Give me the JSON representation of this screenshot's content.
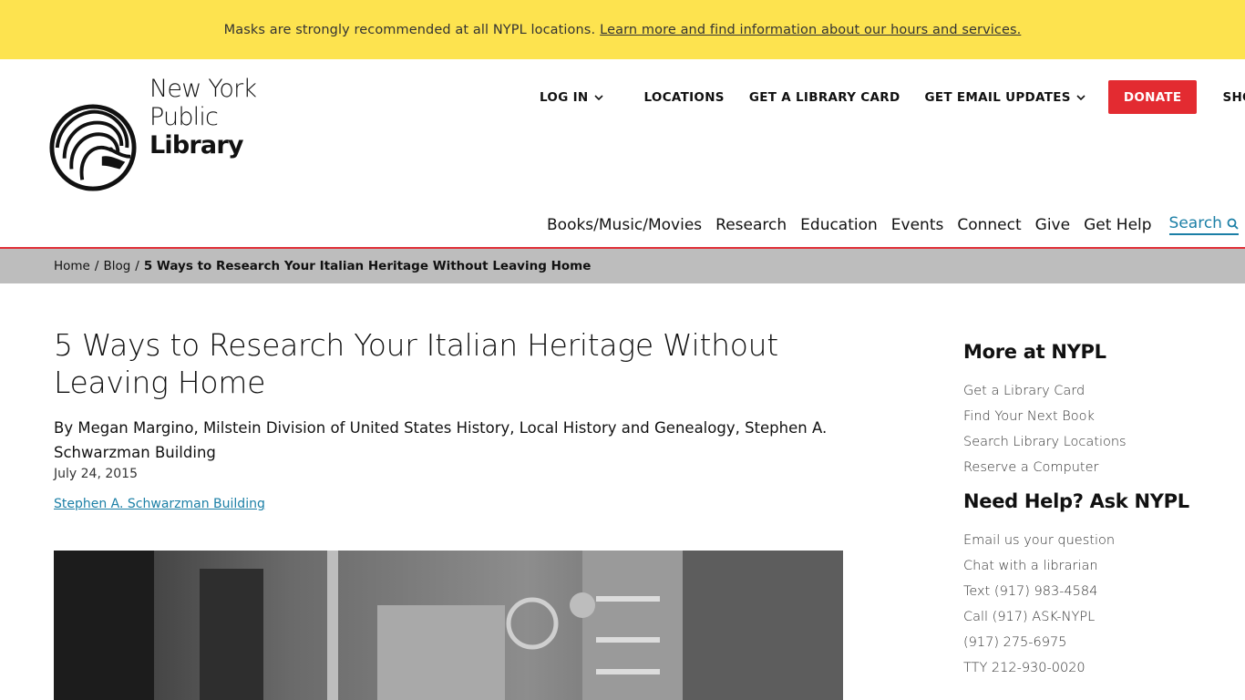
{
  "alert": {
    "text": "Masks are strongly recommended at all NYPL locations.",
    "link": "Learn more and find information about our hours and services."
  },
  "logo": {
    "line1": "New York",
    "line2": "Public",
    "line3": "Library",
    "icon": "lion-icon"
  },
  "topnav": {
    "login": "LOG IN",
    "locations": "LOCATIONS",
    "library_card": "GET A LIBRARY CARD",
    "email_updates": "GET EMAIL UPDATES",
    "donate": "DONATE",
    "shop": "SHOP"
  },
  "mainnav": {
    "items": [
      "Books/Music/Movies",
      "Research",
      "Education",
      "Events",
      "Connect",
      "Give",
      "Get Help"
    ],
    "search": "Search"
  },
  "breadcrumb": {
    "home": "Home",
    "blog": "Blog",
    "current": "5 Ways to Research Your Italian Heritage Without Leaving Home"
  },
  "article": {
    "title": "5 Ways to Research Your Italian Heritage Without Leaving Home",
    "byline": "By Megan Margino, Milstein Division of United States History, Local History and Genealogy, Stephen A. Schwarzman Building",
    "date": "July 24, 2015",
    "location": "Stephen A. Schwarzman Building"
  },
  "sidebar": {
    "more_heading": "More at NYPL",
    "more_links": [
      "Get a Library Card",
      "Find Your Next Book",
      "Search Library Locations",
      "Reserve a Computer"
    ],
    "help_heading": "Need Help? Ask NYPL",
    "help_links": [
      "Email us your question",
      "Chat with a librarian",
      "Text (917) 983-4584",
      "Call (917) ASK-NYPL",
      "(917) 275-6975",
      "TTY 212-930-0020"
    ]
  },
  "colors": {
    "alert_bg": "#fde34f",
    "accent_red": "#e32b31",
    "link_blue": "#1b7fa6",
    "breadcrumb_bg": "#bdbdbd"
  }
}
